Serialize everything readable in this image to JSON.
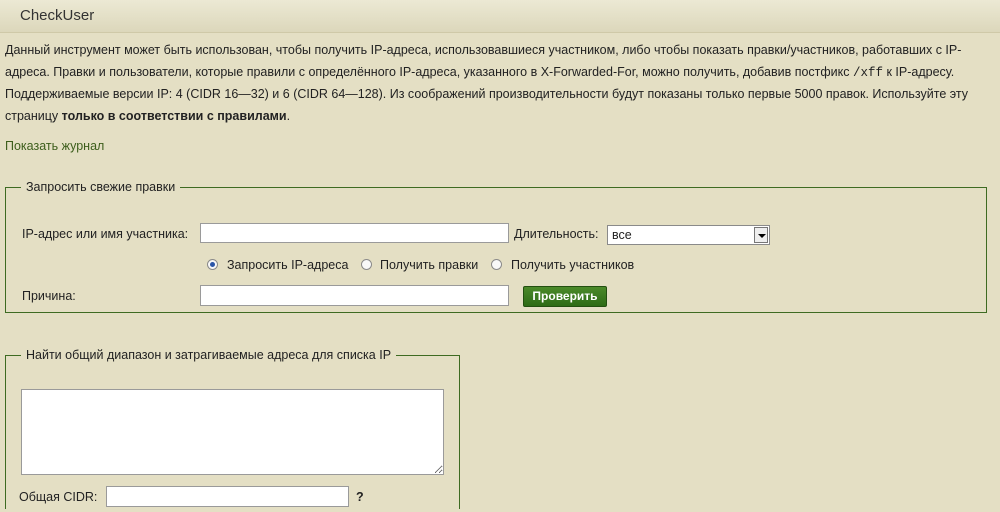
{
  "header": {
    "title": "CheckUser"
  },
  "intro": {
    "part1": "Данный инструмент может быть использован, чтобы получить IP-адреса, использовавшиеся участником, либо чтобы показать правки/участников, работавших с IP-адреса. Правки и пользователи, которые правили с определённого IP-адреса, указанного в X-Forwarded-For, можно получить, добавив постфикс ",
    "code": "/xff",
    "part2": " к IP-адресу. Поддерживаемые версии IP: 4 (CIDR 16—32) и 6 (CIDR 64—128). Из соображений производительности будут показаны только первые 5000 правок. Используйте эту страницу ",
    "bold": "только в соответствии с правилами",
    "end": "."
  },
  "log_link": "Показать журнал",
  "query_form": {
    "legend": "Запросить свежие правки",
    "target_label": "IP-адрес или имя участника:",
    "target_value": "",
    "duration_label": "Длительность:",
    "duration_value": "все",
    "radios": [
      {
        "label": "Запросить IP-адреса",
        "checked": true
      },
      {
        "label": "Получить правки",
        "checked": false
      },
      {
        "label": "Получить участников",
        "checked": false
      }
    ],
    "reason_label": "Причина:",
    "reason_value": "",
    "submit_label": "Проверить"
  },
  "range_form": {
    "legend": "Найти общий диапазон и затрагиваемые адреса для списка IP",
    "ip_list_value": "",
    "cidr_label": "Общая CIDR:",
    "cidr_value": "",
    "help": "?"
  }
}
